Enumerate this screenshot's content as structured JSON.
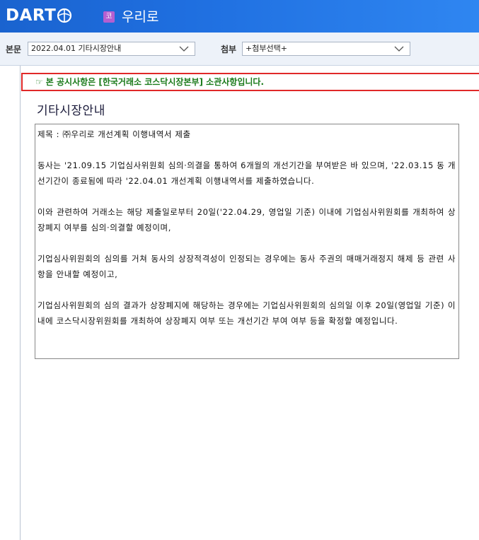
{
  "header": {
    "logo_text": "DART",
    "company_badge": "코",
    "company_name": "우리로"
  },
  "filters": {
    "body_label": "본문",
    "body_select_value": "2022.04.01  기타시장안내",
    "attach_label": "첨부",
    "attach_select_value": "+첨부선택+"
  },
  "notice": {
    "hand_icon": "☞",
    "text": "본 공시사항은 [한국거래소 코스닥시장본부] 소관사항입니다."
  },
  "document": {
    "title": "기타시장안내",
    "subject": "제목 : ㈜우리로 개선계획 이행내역서 제출",
    "paragraphs": [
      "동사는 '21.09.15 기업심사위원회 심의·의결을 통하여 6개월의 개선기간을 부여받은 바 있으며, '22.03.15 동 개선기간이 종료됨에 따라 '22.04.01 개선계획 이행내역서를 제출하였습니다.",
      "이와 관련하여 거래소는 해당 제출일로부터 20일('22.04.29, 영업일 기준) 이내에 기업심사위원회를 개최하여 상장폐지 여부를 심의·의결할 예정이며,",
      "기업심사위원회의 심의를 거쳐 동사의 상장적격성이 인정되는 경우에는 동사 주권의 매매거래정지 해제 등 관련 사항을 안내할 예정이고,",
      "기업심사위원회의 심의 결과가 상장폐지에 해당하는 경우에는 기업심사위원회의 심의일 이후 20일(영업일 기준) 이내에 코스닥시장위원회를 개최하여 상장폐지 여부 또는 개선기간 부여 여부 등을 확정할 예정입니다."
    ]
  },
  "colors": {
    "topbar": "#1f6fe0",
    "notice_border": "#e02828",
    "notice_text": "#1a7a1a",
    "company_badge": "#b45fd0"
  }
}
